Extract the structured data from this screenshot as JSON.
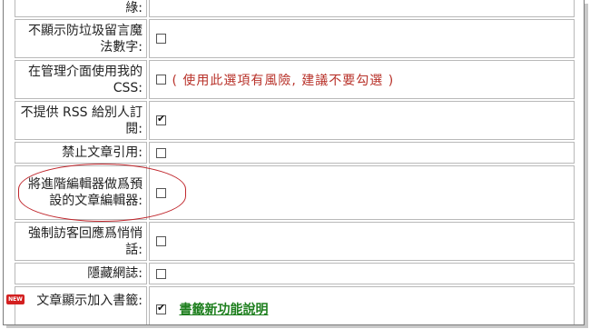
{
  "rows": [
    {
      "label": "綠:",
      "type": "checkbox",
      "checked": false
    },
    {
      "label": "不顯示防垃圾留言魔法數字:",
      "type": "checkbox",
      "checked": false
    },
    {
      "label": "在管理介面使用我的CSS:",
      "type": "checkbox",
      "checked": false,
      "note": "( 使用此選項有風險, 建議不要勾選 )"
    },
    {
      "label": "不提供 RSS 給別人訂閱:",
      "type": "checkbox",
      "checked": true
    },
    {
      "label": "禁止文章引用:",
      "type": "checkbox",
      "checked": false
    },
    {
      "label": "將進階編輯器做爲預設的文章編輯器:",
      "type": "checkbox",
      "checked": false,
      "highlighted": true
    },
    {
      "label": "強制訪客回應爲悄悄話:",
      "type": "checkbox",
      "checked": false
    },
    {
      "label": "隱藏網誌:",
      "type": "checkbox",
      "checked": false
    },
    {
      "label": "文章顯示加入書籤:",
      "type": "checkbox",
      "checked": true,
      "badge": "NEW",
      "link": "書籤新功能說明"
    }
  ],
  "colors": {
    "warning": "#b8322a",
    "link": "#1e7f1e",
    "highlight": "#c0272d",
    "badge": "#d32020"
  }
}
